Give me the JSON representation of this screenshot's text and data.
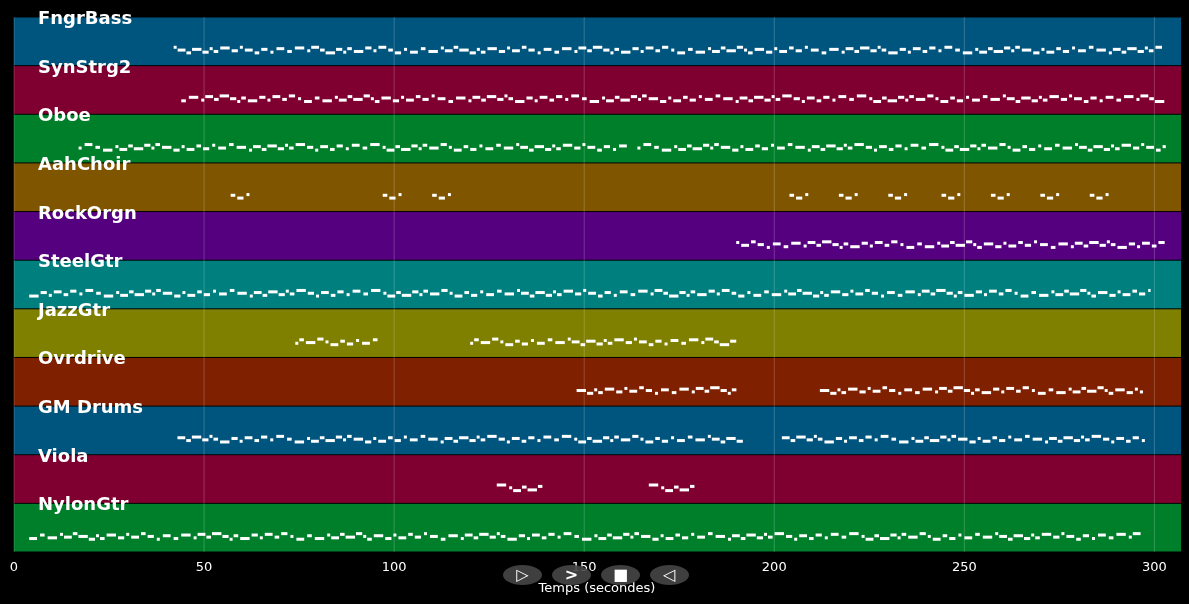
{
  "tracks": [
    {
      "name": "FngrBass",
      "color": "#00557f"
    },
    {
      "name": "SynStrg2",
      "color": "#7f0030"
    },
    {
      "name": "Oboe",
      "color": "#007f2a"
    },
    {
      "name": "AahChoir",
      "color": "#7f5500"
    },
    {
      "name": "RockOrgn",
      "color": "#55007f"
    },
    {
      "name": "SteelGtr",
      "color": "#007f7f"
    },
    {
      "name": "JazzGtr",
      "color": "#7f7f00"
    },
    {
      "name": "Ovrdrive",
      "color": "#7f2000"
    },
    {
      "name": "GM Drums",
      "color": "#00557f"
    },
    {
      "name": "Viola",
      "color": "#7f0030"
    },
    {
      "name": "NylonGtr",
      "color": "#007f2a"
    }
  ],
  "time_axis": {
    "ticks": [
      "0",
      "50",
      "100",
      "150",
      "200",
      "250",
      "300"
    ],
    "label": "Temps (secondes)"
  },
  "controls": [
    {
      "label": "▷"
    },
    {
      "label": ">"
    },
    {
      "label": "■"
    },
    {
      "label": "◁"
    }
  ]
}
